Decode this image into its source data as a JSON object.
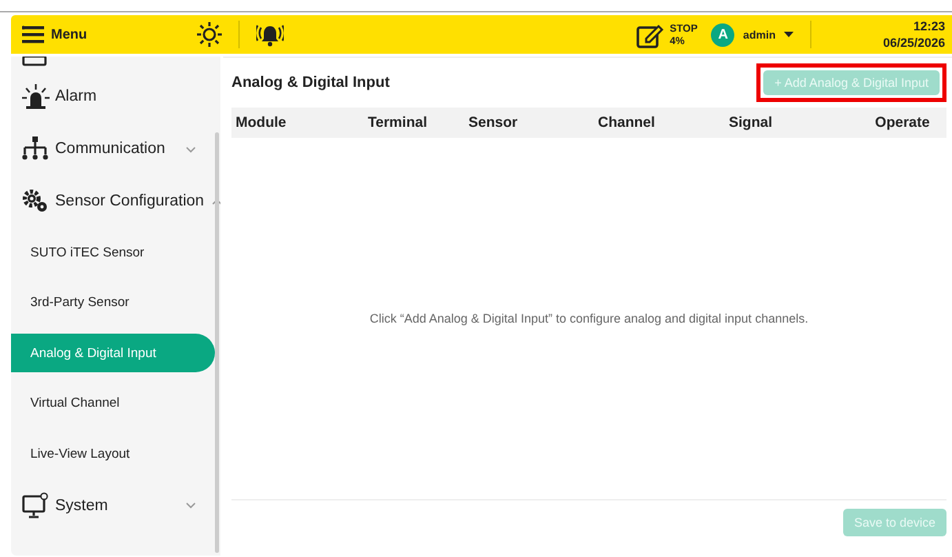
{
  "header": {
    "menu_label": "Menu",
    "status": {
      "line1": "STOP",
      "line2": "4%"
    },
    "user": {
      "initial": "A",
      "name": "admin"
    },
    "time": "12:23",
    "date": "06/25/2026"
  },
  "sidebar": {
    "items": [
      {
        "kind": "cut"
      },
      {
        "kind": "group",
        "label": "Alarm"
      },
      {
        "kind": "group",
        "label": "Communication",
        "expanded": false
      },
      {
        "kind": "group",
        "label": "Sensor Configuration",
        "expanded": true
      },
      {
        "kind": "sub",
        "label": "SUTO iTEC Sensor",
        "selected": false
      },
      {
        "kind": "sub",
        "label": "3rd-Party Sensor",
        "selected": false
      },
      {
        "kind": "sub",
        "label": "Analog & Digital Input",
        "selected": true
      },
      {
        "kind": "sub",
        "label": "Virtual Channel",
        "selected": false
      },
      {
        "kind": "sub",
        "label": "Live-View Layout",
        "selected": false
      },
      {
        "kind": "group",
        "label": "System",
        "expanded": false
      }
    ]
  },
  "panel": {
    "title": "Analog & Digital Input",
    "add_button": {
      "label": "+ Add Analog & Digital Input",
      "disabled": true,
      "highlighted": true
    },
    "table": {
      "columns": [
        "Module",
        "Terminal",
        "Sensor",
        "Channel",
        "Signal",
        "Operate"
      ]
    },
    "empty_message": "Click “Add Analog & Digital Input” to configure analog and digital input channels.",
    "save_button": {
      "label": "Save to device",
      "disabled": true
    }
  }
}
